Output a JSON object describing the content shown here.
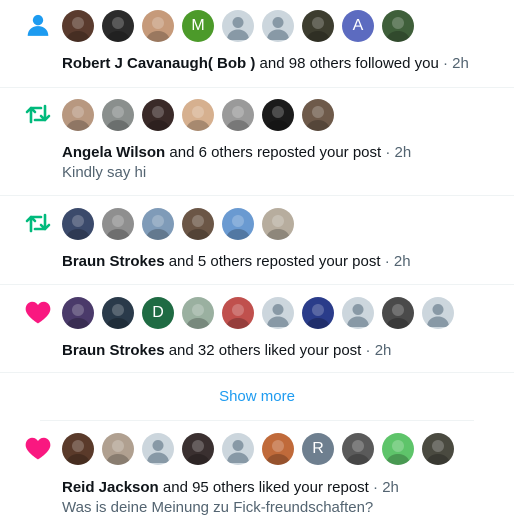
{
  "colors": {
    "follow_blue": "#1d9bf0",
    "repost_green": "#00ba7c",
    "like_pink": "#f91880",
    "text": "#0f1419",
    "muted": "#536471",
    "link": "#1d9bf0"
  },
  "notifications": [
    {
      "type": "follow",
      "icon": "person-icon",
      "avatars": [
        {
          "kind": "photo",
          "color": "#5a3b2e"
        },
        {
          "kind": "photo",
          "color": "#2b2b2b"
        },
        {
          "kind": "photo",
          "color": "#c69a7a"
        },
        {
          "kind": "letter",
          "letter": "M",
          "color": "#4c9a2a"
        },
        {
          "kind": "default"
        },
        {
          "kind": "default"
        },
        {
          "kind": "photo",
          "color": "#3d3d2f"
        },
        {
          "kind": "letter",
          "letter": "A",
          "color": "#5c6bc0"
        },
        {
          "kind": "photo",
          "color": "#3f5f3a"
        }
      ],
      "actor": "Robert J Cavanaugh( Bob )",
      "action": " and 98 others followed you",
      "time": "2h",
      "body": ""
    },
    {
      "type": "repost",
      "icon": "repost-icon",
      "avatars": [
        {
          "kind": "photo",
          "color": "#b89880"
        },
        {
          "kind": "photo",
          "color": "#8a8f8d"
        },
        {
          "kind": "photo",
          "color": "#3a2a28"
        },
        {
          "kind": "photo",
          "color": "#d6b08f"
        },
        {
          "kind": "photo",
          "color": "#9a9a9a"
        },
        {
          "kind": "photo",
          "color": "#1b1b1b"
        },
        {
          "kind": "photo",
          "color": "#6e5a4a"
        }
      ],
      "actor": "Angela Wilson",
      "action": " and 6 others reposted your post",
      "time": "2h",
      "body": "Kindly say hi"
    },
    {
      "type": "repost",
      "icon": "repost-icon",
      "avatars": [
        {
          "kind": "photo",
          "color": "#3b4a6b"
        },
        {
          "kind": "photo",
          "color": "#8f8f8f"
        },
        {
          "kind": "photo",
          "color": "#7f9bb8"
        },
        {
          "kind": "photo",
          "color": "#6b5646"
        },
        {
          "kind": "photo",
          "color": "#6a9ad1"
        },
        {
          "kind": "photo",
          "color": "#b7ad9e"
        }
      ],
      "actor": "Braun Strokes",
      "action": " and 5 others reposted your post",
      "time": "2h",
      "body": ""
    },
    {
      "type": "like",
      "icon": "heart-icon",
      "avatars": [
        {
          "kind": "photo",
          "color": "#4a3a6a"
        },
        {
          "kind": "photo",
          "color": "#2a3a4a"
        },
        {
          "kind": "letter",
          "letter": "D",
          "color": "#1f6b43"
        },
        {
          "kind": "photo",
          "color": "#9ab0a0"
        },
        {
          "kind": "photo",
          "color": "#c0504d"
        },
        {
          "kind": "default"
        },
        {
          "kind": "photo",
          "color": "#2a3c8a"
        },
        {
          "kind": "default"
        },
        {
          "kind": "photo",
          "color": "#4a4a4a"
        },
        {
          "kind": "default"
        }
      ],
      "actor": "Braun Strokes",
      "action": " and 32 others liked your post",
      "time": "2h",
      "body": ""
    },
    {
      "type": "like",
      "icon": "heart-icon",
      "avatars": [
        {
          "kind": "photo",
          "color": "#5a3a2a"
        },
        {
          "kind": "photo",
          "color": "#b0a090"
        },
        {
          "kind": "default"
        },
        {
          "kind": "photo",
          "color": "#3a3030"
        },
        {
          "kind": "default"
        },
        {
          "kind": "photo",
          "color": "#c06a3a"
        },
        {
          "kind": "letter",
          "letter": "R",
          "color": "#6e7f8f"
        },
        {
          "kind": "photo",
          "color": "#5a5a5a"
        },
        {
          "kind": "photo",
          "color": "#5ec46a"
        },
        {
          "kind": "photo",
          "color": "#4a4a40"
        }
      ],
      "actor": "Reid Jackson",
      "action": " and 95 others liked your repost",
      "time": "2h",
      "body": "Was is deine Meinung zu Fick-freundschaften?"
    }
  ],
  "show_more": "Show more"
}
